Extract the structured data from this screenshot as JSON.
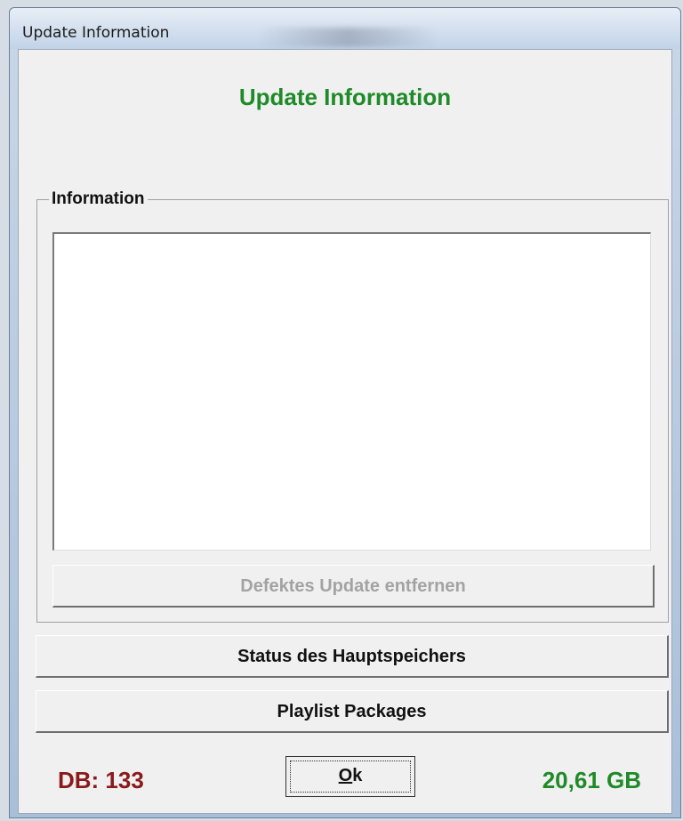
{
  "window": {
    "title": "Update Information"
  },
  "dialog": {
    "heading": "Update Information",
    "group_label": "Information",
    "info_text": "",
    "remove_button": "Defektes Update entfernen",
    "memory_status_button": "Status des Hauptspeichers",
    "playlist_button": "Playlist Packages",
    "ok_mnemonic": "O",
    "ok_rest": "k",
    "db_label": "DB: 133",
    "size_label": "20,61 GB"
  },
  "colors": {
    "heading": "#1f8a28",
    "db": "#8b1a1a",
    "size": "#1f8a28",
    "disabled_text": "#a3a3a3"
  }
}
